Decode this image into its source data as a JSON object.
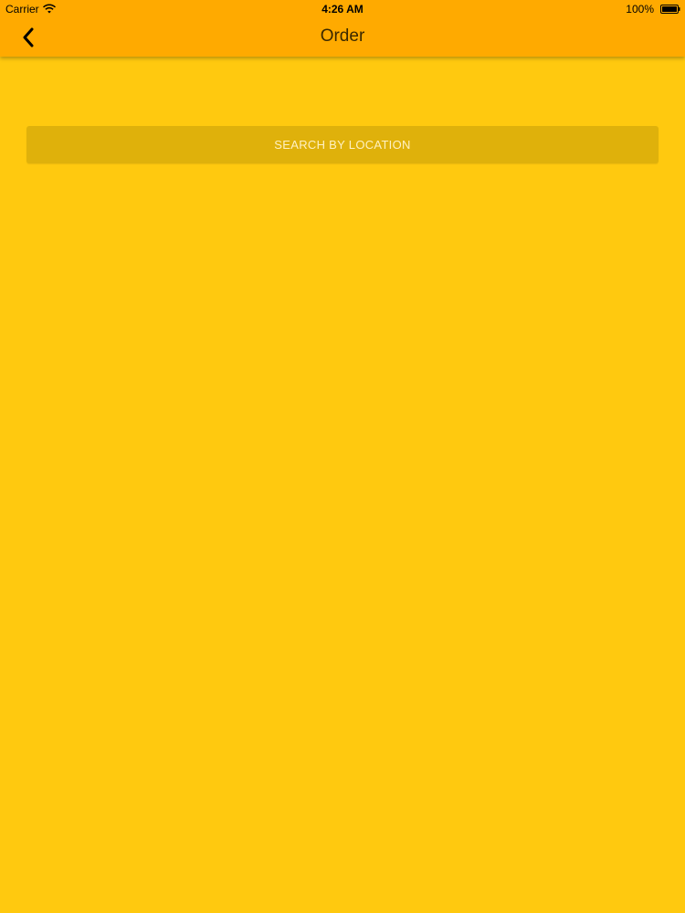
{
  "status_bar": {
    "carrier": "Carrier",
    "time": "4:26 AM",
    "battery_percent": "100%",
    "icons": [
      "wifi-icon",
      "battery-icon"
    ]
  },
  "nav_bar": {
    "title": "Order",
    "back_icon": "chevron-left-icon"
  },
  "main": {
    "search_button_label": "SEARCH BY LOCATION"
  },
  "colors": {
    "background": "#ffc90f",
    "header": "#ffaa00",
    "search_button": "#dfb10b",
    "search_text": "#fff1c2"
  }
}
